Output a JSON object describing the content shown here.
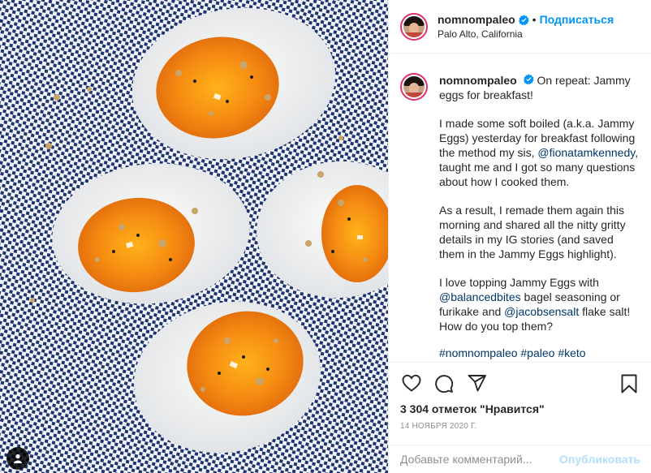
{
  "post": {
    "username": "nomnompaleo",
    "location": "Palo Alto, California",
    "follow_label": "Подписаться",
    "dot": "•",
    "verified_icon": "verified-badge-icon",
    "accent_color": "#0095f6"
  },
  "caption": {
    "username": "nomnompaleo",
    "intro": "On repeat: Jammy eggs for breakfast!",
    "p1_text_before": "I made some soft boiled (a.k.a. Jammy Eggs) yesterday for breakfast following the method my sis, ",
    "p1_mention": "@fionatamkennedy",
    "p1_text_after": ", taught me and I got so many questions about how I cooked them.",
    "p2": "As a result, I remade them again this morning and shared all the nitty gritty details in my IG stories (and saved them in the Jammy Eggs highlight).",
    "p3_text_before": "I love topping Jammy Eggs with ",
    "p3_mention1": "@balancedbites",
    "p3_text_mid": " bagel seasoning or furikake and ",
    "p3_mention2": "@jacobsensalt",
    "p3_text_after": " flake salt! How do you top them?",
    "tags": "#nomnompaleo #paleo #keto"
  },
  "actions": {
    "like_icon": "heart-icon",
    "comment_icon": "comment-icon",
    "share_icon": "share-icon",
    "save_icon": "bookmark-icon"
  },
  "likes": "3 304 отметок \"Нравится\"",
  "date": "14 НОЯБРЯ 2020 Г.",
  "comment": {
    "placeholder": "Добавьте комментарий...",
    "publish_label": "Опубликовать"
  }
}
